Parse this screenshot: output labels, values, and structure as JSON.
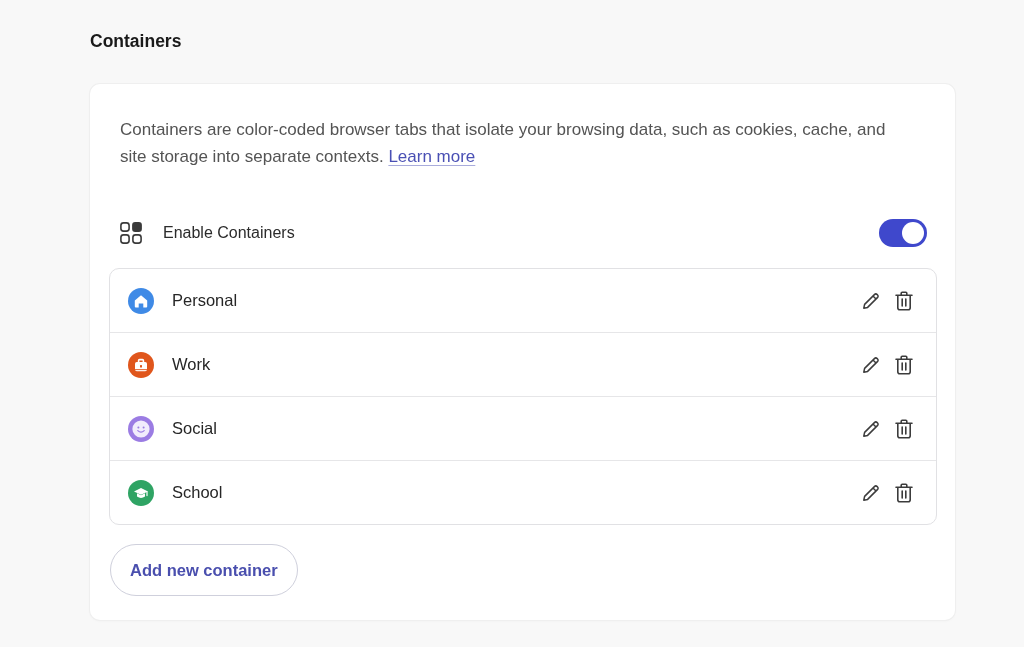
{
  "page": {
    "title": "Containers"
  },
  "card": {
    "description": "Containers are color-coded browser tabs that isolate your browsing data, such as cookies, cache, and site storage into separate contexts.",
    "link": "Learn more",
    "enable": {
      "label": "Enable Containers",
      "on": true
    },
    "containers": [
      {
        "name": "Personal",
        "color": "#3f8ae6"
      },
      {
        "name": "Work",
        "color": "#e0561c"
      },
      {
        "name": "Social",
        "color": "#9b7ce3"
      },
      {
        "name": "School",
        "color": "#2fa464"
      }
    ],
    "add_button": "Add new container"
  }
}
